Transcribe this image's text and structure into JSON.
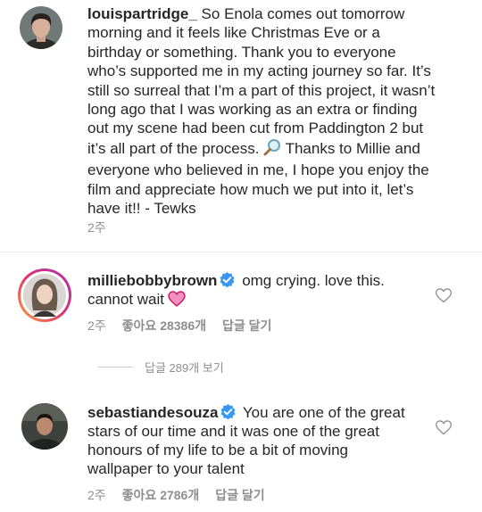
{
  "caption": {
    "username": "louispartridge_",
    "text": "So Enola comes out tomorrow morning and it feels like Christmas Eve or a birthday or something. Thank you to everyone who’s supported me in my acting journey so far. It’s still so surreal that I’m a part of this project, it wasn’t long ago that I was working as an extra or finding out my scene had been cut from Paddington 2 but it’s all part of the process. ",
    "text2": " Thanks to Millie and everyone who believed in me, I hope you enjoy the film and appreciate how much we put into it, let’s have it!! - Tewks",
    "emoji_icon": "magnifying-glass-icon",
    "time": "2주"
  },
  "comments": [
    {
      "username": "milliebobbybrown",
      "verified": true,
      "text": "omg crying. love this. cannot wait",
      "emoji_icon": "pink-heart-icon",
      "time": "2주",
      "likes": "좋아요 28386개",
      "reply": "답글 달기"
    },
    {
      "username": "sebastiandesouza",
      "verified": true,
      "text": "You are one of the great stars of our time and it was one of the great honours of my life to be a bit of moving wallpaper to your talent",
      "time": "2주",
      "likes": "좋아요 2786개",
      "reply": "답글 달기"
    }
  ],
  "view_replies": "답글 289개 보기",
  "colors": {
    "text": "#262626",
    "meta": "#8e8e8e",
    "verified": "#3897f0",
    "divider": "#efefef"
  }
}
